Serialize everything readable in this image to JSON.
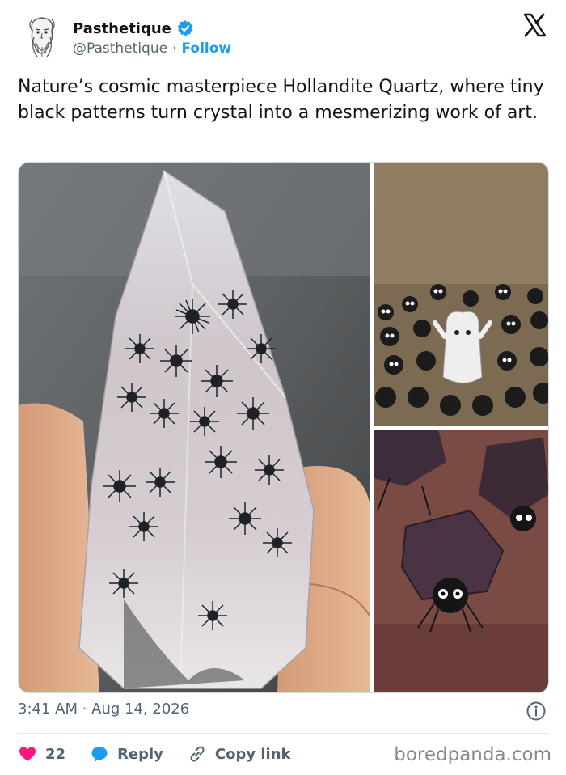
{
  "author": {
    "display_name": "Pasthetique",
    "handle": "@Pasthetique",
    "separator": "·",
    "follow_label": "Follow"
  },
  "tweet": {
    "text": "Nature’s cosmic masterpiece Hollandite Quartz, where tiny black patterns turn crystal into a mesmerizing work of art.",
    "timestamp": "3:41 AM · Aug 14, 2026"
  },
  "actions": {
    "like_count": "22",
    "reply_label": "Reply",
    "copy_link_label": "Copy link"
  },
  "watermark": "boredpanda.com",
  "colors": {
    "accent": "#1d9bf0",
    "like": "#f91880",
    "text": "#0f1419",
    "muted": "#536471"
  },
  "icons": [
    "verified-badge-icon",
    "x-logo-icon",
    "info-icon",
    "heart-icon",
    "reply-bubble-icon",
    "link-icon"
  ]
}
